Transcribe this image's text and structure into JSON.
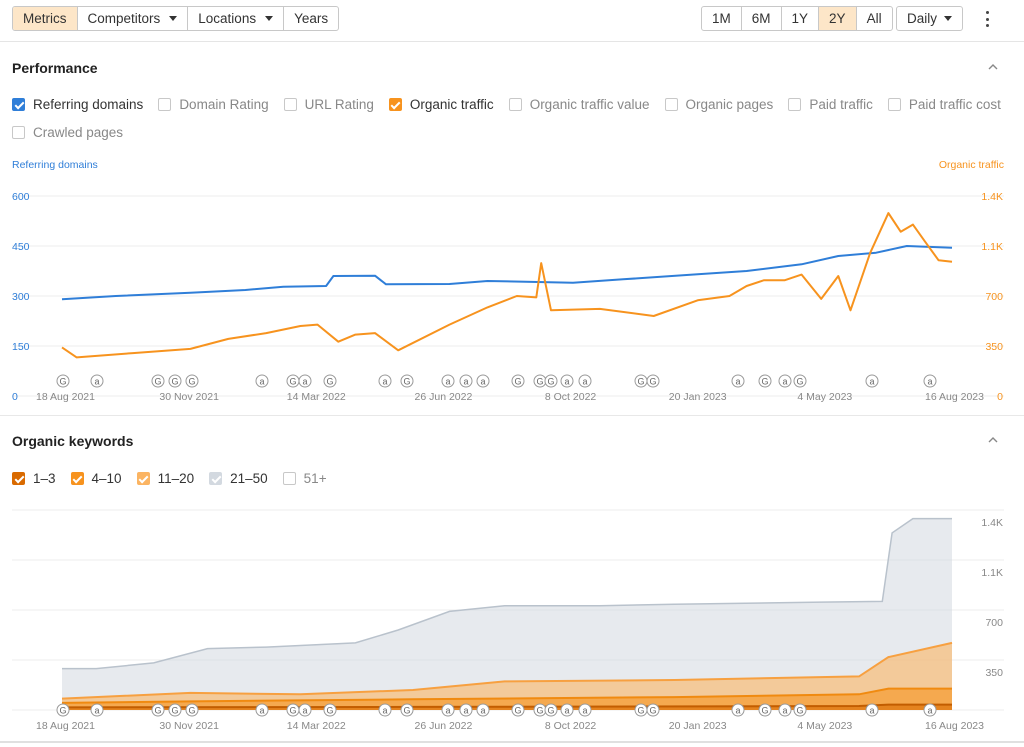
{
  "toolbar": {
    "tabs": [
      {
        "label": "Metrics",
        "active": true
      },
      {
        "label": "Competitors",
        "dropdown": true
      },
      {
        "label": "Locations",
        "dropdown": true
      },
      {
        "label": "Years"
      }
    ],
    "ranges": [
      {
        "label": "1M"
      },
      {
        "label": "6M"
      },
      {
        "label": "1Y"
      },
      {
        "label": "2Y",
        "active": true
      },
      {
        "label": "All"
      }
    ],
    "interval": "Daily"
  },
  "performance": {
    "title": "Performance",
    "metrics": [
      {
        "label": "Referring domains",
        "checked": true,
        "color": "#2f7ed8"
      },
      {
        "label": "Domain Rating",
        "checked": false
      },
      {
        "label": "URL Rating",
        "checked": false
      },
      {
        "label": "Organic traffic",
        "checked": true,
        "color": "#f7931e"
      },
      {
        "label": "Organic traffic value",
        "checked": false
      },
      {
        "label": "Organic pages",
        "checked": false
      },
      {
        "label": "Paid traffic",
        "checked": false
      },
      {
        "label": "Paid traffic cost",
        "checked": false
      },
      {
        "label": "Crawled pages",
        "checked": false
      }
    ],
    "left_axis_title": "Referring domains",
    "right_axis_title": "Organic traffic"
  },
  "keywords": {
    "title": "Organic keywords",
    "legend": [
      {
        "label": "1–3",
        "checked": true,
        "color": "#d96a00"
      },
      {
        "label": "4–10",
        "checked": true,
        "color": "#f7931e"
      },
      {
        "label": "11–20",
        "checked": true,
        "color": "#fbb462"
      },
      {
        "label": "21–50",
        "checked": true,
        "color": "#d3d9e0"
      },
      {
        "label": "51+",
        "checked": false
      }
    ]
  },
  "x_dates": [
    "18 Aug 2021",
    "30 Nov 2021",
    "14 Mar 2022",
    "26 Jun 2022",
    "8 Oct 2022",
    "20 Jan 2023",
    "4 May 2023",
    "16 Aug 2023"
  ],
  "annotations": [
    "G",
    "a",
    "G",
    "G",
    "G",
    "a",
    "G",
    "a",
    "G",
    "a",
    "G",
    "a",
    "a",
    "a",
    "G",
    "G",
    "G",
    "a",
    "a",
    "G",
    "G",
    "a",
    "G",
    "a",
    "G",
    "a",
    "a"
  ],
  "chart_data": [
    {
      "type": "line",
      "x_range": [
        "2021-08-18",
        "2023-08-16"
      ],
      "y_left": {
        "label": "Referring domains",
        "ticks": [
          0,
          150,
          300,
          450,
          600
        ],
        "ylim": [
          0,
          600
        ]
      },
      "y_right": {
        "label": "Organic traffic",
        "tick_labels": [
          "0",
          "350",
          "700",
          "1.1K",
          "1.4K"
        ],
        "ylim": [
          0,
          1400
        ]
      },
      "series": [
        {
          "name": "Referring domains",
          "axis": "left",
          "color": "#2f7ed8",
          "points": [
            [
              "2021-08-18",
              290
            ],
            [
              "2021-10-01",
              300
            ],
            [
              "2021-12-01",
              310
            ],
            [
              "2022-01-15",
              318
            ],
            [
              "2022-02-15",
              328
            ],
            [
              "2022-03-22",
              330
            ],
            [
              "2022-03-28",
              360
            ],
            [
              "2022-05-01",
              361
            ],
            [
              "2022-05-10",
              335
            ],
            [
              "2022-07-01",
              336
            ],
            [
              "2022-08-01",
              345
            ],
            [
              "2022-10-10",
              340
            ],
            [
              "2022-11-20",
              350
            ],
            [
              "2023-01-20",
              365
            ],
            [
              "2023-03-01",
              375
            ],
            [
              "2023-04-15",
              395
            ],
            [
              "2023-05-15",
              420
            ],
            [
              "2023-06-15",
              430
            ],
            [
              "2023-07-10",
              450
            ],
            [
              "2023-08-16",
              445
            ]
          ]
        },
        {
          "name": "Organic traffic",
          "axis": "right",
          "color": "#f7931e",
          "points": [
            [
              "2021-08-18",
              340
            ],
            [
              "2021-08-30",
              270
            ],
            [
              "2021-10-15",
              300
            ],
            [
              "2021-12-01",
              330
            ],
            [
              "2022-01-01",
              400
            ],
            [
              "2022-02-01",
              440
            ],
            [
              "2022-03-01",
              490
            ],
            [
              "2022-03-15",
              500
            ],
            [
              "2022-04-01",
              380
            ],
            [
              "2022-04-15",
              430
            ],
            [
              "2022-05-01",
              440
            ],
            [
              "2022-05-20",
              320
            ],
            [
              "2022-07-01",
              500
            ],
            [
              "2022-08-01",
              620
            ],
            [
              "2022-08-25",
              700
            ],
            [
              "2022-09-10",
              690
            ],
            [
              "2022-09-14",
              930
            ],
            [
              "2022-09-22",
              600
            ],
            [
              "2022-11-01",
              610
            ],
            [
              "2022-12-15",
              560
            ],
            [
              "2023-01-20",
              670
            ],
            [
              "2023-02-15",
              700
            ],
            [
              "2023-03-01",
              770
            ],
            [
              "2023-03-15",
              810
            ],
            [
              "2023-04-01",
              810
            ],
            [
              "2023-04-15",
              850
            ],
            [
              "2023-05-01",
              680
            ],
            [
              "2023-05-15",
              840
            ],
            [
              "2023-05-25",
              600
            ],
            [
              "2023-06-10",
              1000
            ],
            [
              "2023-06-25",
              1280
            ],
            [
              "2023-07-05",
              1150
            ],
            [
              "2023-07-15",
              1200
            ],
            [
              "2023-07-25",
              1080
            ],
            [
              "2023-08-05",
              950
            ],
            [
              "2023-08-16",
              940
            ]
          ]
        }
      ]
    },
    {
      "type": "area",
      "stacked": true,
      "x_range": [
        "2021-08-18",
        "2023-08-16"
      ],
      "y_right": {
        "tick_labels": [
          "350",
          "700",
          "1.1K",
          "1.4K"
        ],
        "ylim": [
          0,
          1400
        ]
      },
      "series": [
        {
          "name": "1–3",
          "color": "#d96a00",
          "points": [
            [
              "2021-08-18",
              18
            ],
            [
              "2022-06-01",
              22
            ],
            [
              "2023-06-01",
              28
            ],
            [
              "2023-06-25",
              38
            ],
            [
              "2023-08-16",
              38
            ]
          ]
        },
        {
          "name": "4–10",
          "color": "#f7931e",
          "points": [
            [
              "2021-08-18",
              50
            ],
            [
              "2021-12-01",
              60
            ],
            [
              "2022-06-01",
              75
            ],
            [
              "2023-01-01",
              90
            ],
            [
              "2023-06-01",
              110
            ],
            [
              "2023-06-25",
              150
            ],
            [
              "2023-08-16",
              150
            ]
          ]
        },
        {
          "name": "11–20",
          "color": "#fbb462",
          "points": [
            [
              "2021-08-18",
              80
            ],
            [
              "2021-12-01",
              120
            ],
            [
              "2022-03-01",
              110
            ],
            [
              "2022-06-01",
              140
            ],
            [
              "2022-08-15",
              200
            ],
            [
              "2023-01-01",
              210
            ],
            [
              "2023-06-01",
              235
            ],
            [
              "2023-06-25",
              370
            ],
            [
              "2023-08-16",
              470
            ]
          ]
        },
        {
          "name": "21–50",
          "color": "#d3d9e0",
          "points": [
            [
              "2021-08-18",
              290
            ],
            [
              "2021-09-15",
              290
            ],
            [
              "2021-11-01",
              330
            ],
            [
              "2021-12-15",
              430
            ],
            [
              "2022-02-01",
              440
            ],
            [
              "2022-04-15",
              470
            ],
            [
              "2022-05-20",
              560
            ],
            [
              "2022-07-01",
              690
            ],
            [
              "2022-08-15",
              730
            ],
            [
              "2022-11-01",
              730
            ],
            [
              "2023-01-01",
              740
            ],
            [
              "2023-05-01",
              755
            ],
            [
              "2023-06-20",
              760
            ],
            [
              "2023-06-28",
              1240
            ],
            [
              "2023-07-15",
              1340
            ],
            [
              "2023-08-16",
              1340
            ]
          ]
        }
      ]
    }
  ]
}
